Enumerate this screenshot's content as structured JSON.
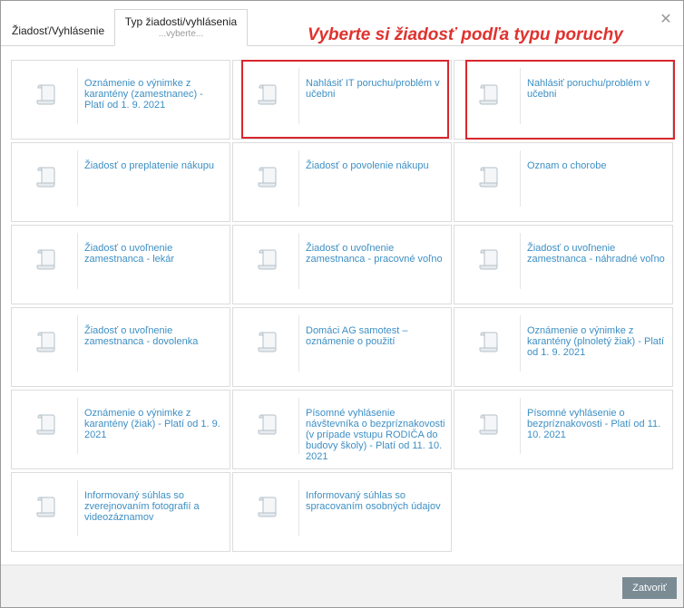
{
  "tabs": [
    {
      "label": "Žiadosť/Vyhlásenie"
    },
    {
      "label": "Typ žiadosti/vyhlásenia",
      "sub": "...vyberte..."
    }
  ],
  "annotation": "Vyberte si žiadosť podľa typu poruchy",
  "close_icon": "close-icon",
  "cards": [
    {
      "label": "Oznámenie o výnimke z karantény (zamestnanec) - Platí od 1. 9. 2021"
    },
    {
      "label": "Nahlásiť IT poruchu/problém v učebni"
    },
    {
      "label": "Nahlásiť poruchu/problém v učebni"
    },
    {
      "label": "Žiadosť o preplatenie nákupu"
    },
    {
      "label": "Žiadosť o povolenie nákupu"
    },
    {
      "label": "Oznam o chorobe"
    },
    {
      "label": "Žiadosť o uvoľnenie zamestnanca - lekár"
    },
    {
      "label": "Žiadosť o uvoľnenie zamestnanca - pracovné voľno"
    },
    {
      "label": "Žiadosť o uvoľnenie zamestnanca - náhradné voľno"
    },
    {
      "label": "Žiadosť o uvoľnenie zamestnanca - dovolenka"
    },
    {
      "label": "Domáci AG samotest – oznámenie o použití"
    },
    {
      "label": "Oznámenie o výnimke z karantény (plnoletý žiak) - Platí od 1. 9. 2021"
    },
    {
      "label": "Oznámenie o výnimke z karantény (žiak) - Platí od 1. 9. 2021"
    },
    {
      "label": "Písomné vyhlásenie návštevníka o bezpríznakovosti (v prípade vstupu RODIČA do budovy školy) - Platí od 11. 10. 2021"
    },
    {
      "label": "Písomné vyhlásenie o bezpríznakovosti - Platí od 11. 10. 2021"
    },
    {
      "label": "Informovaný súhlas so zverejnovaním fotografií a videozáznamov"
    },
    {
      "label": "Informovaný súhlas so spracovaním osobných údajov"
    }
  ],
  "colors": {
    "link": "#3d8fc4",
    "annotation": "#e0322e",
    "highlight": "#d9262d",
    "button": "#7a8b94"
  },
  "footer": {
    "close_label": "Zatvoriť"
  }
}
